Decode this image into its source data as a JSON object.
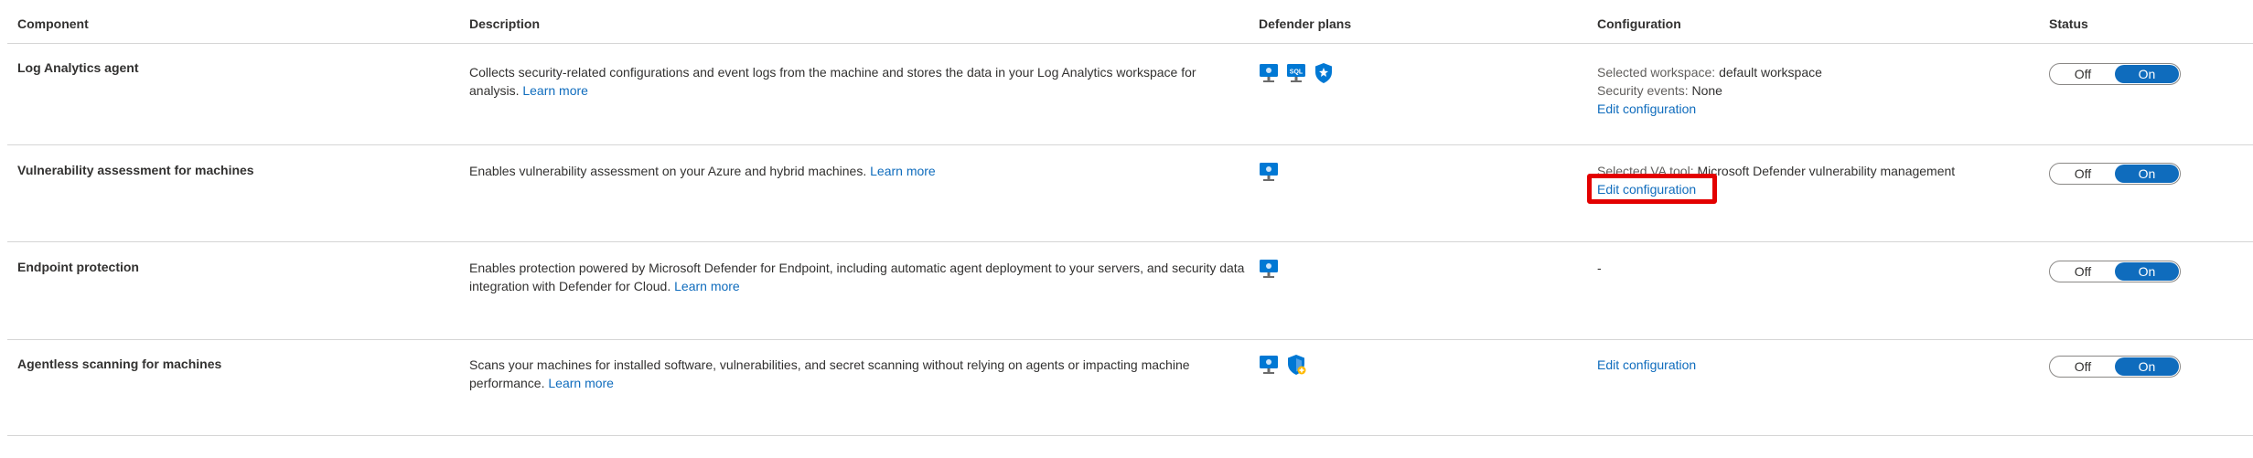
{
  "headers": {
    "component": "Component",
    "description": "Description",
    "plans": "Defender plans",
    "configuration": "Configuration",
    "status": "Status"
  },
  "rows": [
    {
      "name": "Log Analytics agent",
      "description": "Collects security-related configurations and event logs from the machine and stores the data in your Log Analytics workspace for analysis.",
      "learn_more": "Learn more",
      "plans": [
        "server-icon",
        "sql-server-icon",
        "shield-icon"
      ],
      "config": {
        "line1_key": "Selected workspace:",
        "line1_val": " default workspace",
        "line2_key": "Security events:",
        "line2_val": " None",
        "edit": "Edit configuration"
      },
      "status": {
        "off": "Off",
        "on": "On"
      }
    },
    {
      "name": "Vulnerability assessment for machines",
      "description": "Enables vulnerability assessment on your Azure and hybrid machines.",
      "learn_more": "Learn more",
      "plans": [
        "server-icon"
      ],
      "config": {
        "line1_key": "Selected VA tool:",
        "line1_val": " Microsoft Defender vulnerability management",
        "edit": "Edit configuration"
      },
      "status": {
        "off": "Off",
        "on": "On"
      }
    },
    {
      "name": "Endpoint protection",
      "description": "Enables protection powered by Microsoft Defender for Endpoint, including automatic agent deployment to your servers, and security data integration with Defender for Cloud.",
      "learn_more": "Learn more",
      "plans": [
        "server-icon"
      ],
      "config": {
        "text": "-"
      },
      "status": {
        "off": "Off",
        "on": "On"
      }
    },
    {
      "name": "Agentless scanning for machines",
      "description": "Scans your machines for installed software, vulnerabilities, and secret scanning without relying on agents or impacting machine performance.",
      "learn_more": "Learn more",
      "plans": [
        "server-icon",
        "shield-plus-icon"
      ],
      "config": {
        "edit": "Edit configuration"
      },
      "status": {
        "off": "Off",
        "on": "On"
      }
    }
  ]
}
